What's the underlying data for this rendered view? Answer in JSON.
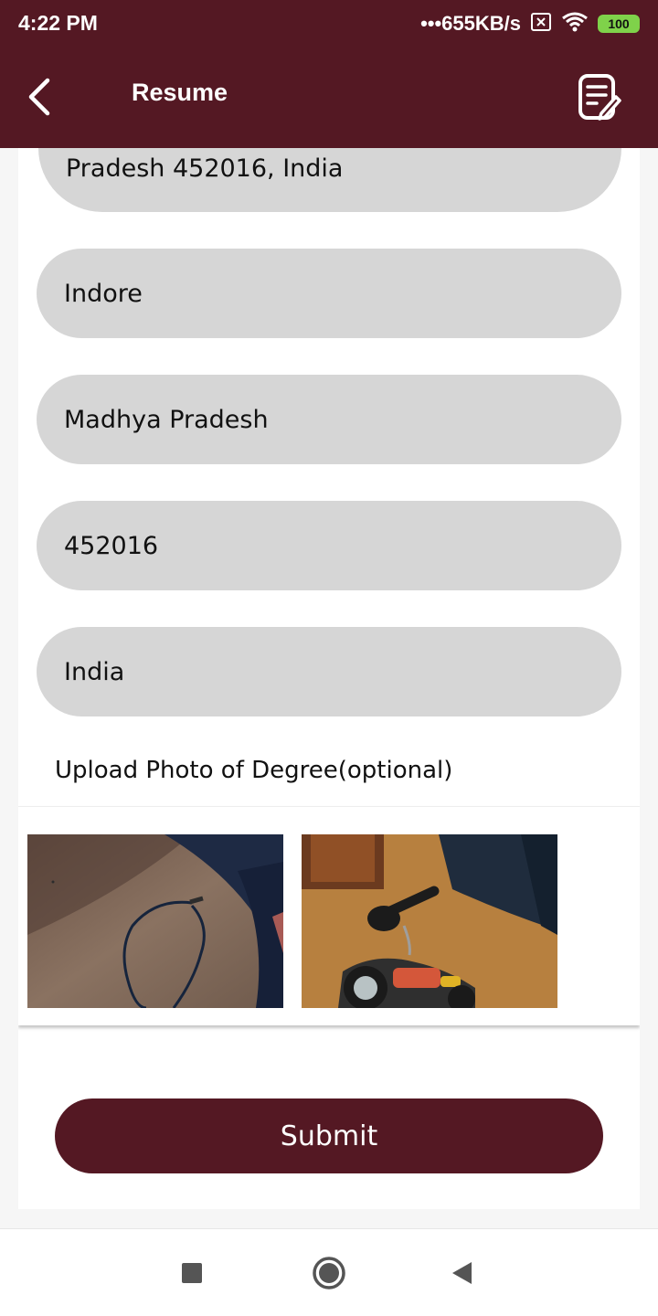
{
  "status_bar": {
    "time": "4:22 PM",
    "network_speed": "•••655KB/s",
    "battery": "100",
    "icons": [
      "sim-x-icon",
      "wifi-icon",
      "battery-icon"
    ]
  },
  "app_bar": {
    "title": "Resume",
    "icons": [
      "back-arrow-icon",
      "edit-document-icon"
    ]
  },
  "form": {
    "address_tail": "Pradesh 452016, India",
    "city": "Indore",
    "state": "Madhya Pradesh",
    "pincode": "452016",
    "country": "India",
    "upload_label": "Upload Photo of Degree(optional)",
    "photos": [
      "degree-photo-1",
      "degree-photo-2"
    ],
    "submit_label": "Submit"
  },
  "colors": {
    "primary": "#541823",
    "field_bg": "#d6d6d6",
    "battery_green": "#7fd24a"
  },
  "nav_bar": {
    "icons": [
      "recents-square-icon",
      "home-circle-icon",
      "back-triangle-icon"
    ]
  }
}
